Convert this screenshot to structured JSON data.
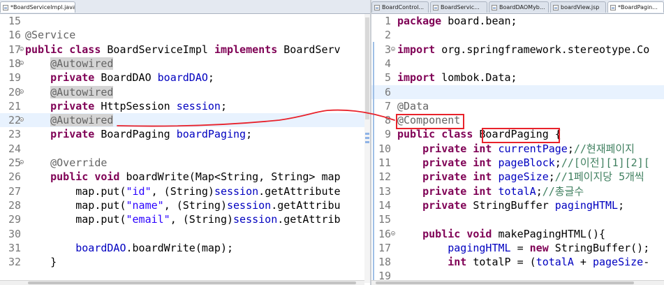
{
  "left_editor": {
    "tab": {
      "label": "*BoardServiceImpl.java",
      "close": "☒"
    },
    "lines": [
      {
        "num": "15",
        "tokens": []
      },
      {
        "num": "16",
        "tokens": [
          {
            "t": "@Service",
            "c": "ann"
          }
        ]
      },
      {
        "num": "17",
        "fold": true,
        "tokens": [
          {
            "t": "public class ",
            "c": "kw"
          },
          {
            "t": "BoardServiceImpl ",
            "c": ""
          },
          {
            "t": "implements ",
            "c": "kw"
          },
          {
            "t": "BoardServ",
            "c": ""
          }
        ]
      },
      {
        "num": "18",
        "fold": true,
        "tokens": [
          {
            "t": "    ",
            "c": ""
          },
          {
            "t": "@Autowired",
            "c": "ann occ"
          }
        ]
      },
      {
        "num": "19",
        "tokens": [
          {
            "t": "    ",
            "c": ""
          },
          {
            "t": "private ",
            "c": "kw"
          },
          {
            "t": "BoardDAO ",
            "c": ""
          },
          {
            "t": "boardDAO",
            "c": "field"
          },
          {
            "t": ";",
            "c": ""
          }
        ]
      },
      {
        "num": "20",
        "fold": true,
        "tokens": [
          {
            "t": "    ",
            "c": ""
          },
          {
            "t": "@Autowired",
            "c": "ann occ"
          }
        ]
      },
      {
        "num": "21",
        "tokens": [
          {
            "t": "    ",
            "c": ""
          },
          {
            "t": "private ",
            "c": "kw"
          },
          {
            "t": "HttpSession ",
            "c": ""
          },
          {
            "t": "session",
            "c": "field"
          },
          {
            "t": ";",
            "c": ""
          }
        ]
      },
      {
        "num": "22",
        "fold": true,
        "current": true,
        "tokens": [
          {
            "t": "    ",
            "c": ""
          },
          {
            "t": "@Autowired",
            "c": "ann occ"
          }
        ]
      },
      {
        "num": "23",
        "tokens": [
          {
            "t": "    ",
            "c": ""
          },
          {
            "t": "private ",
            "c": "kw"
          },
          {
            "t": "BoardPaging ",
            "c": ""
          },
          {
            "t": "boardPaging",
            "c": "field"
          },
          {
            "t": ";",
            "c": ""
          }
        ]
      },
      {
        "num": "24",
        "tokens": []
      },
      {
        "num": "25",
        "fold": true,
        "tokens": [
          {
            "t": "    ",
            "c": ""
          },
          {
            "t": "@Override",
            "c": "ann"
          }
        ]
      },
      {
        "num": "26",
        "tokens": [
          {
            "t": "    ",
            "c": ""
          },
          {
            "t": "public void ",
            "c": "kw"
          },
          {
            "t": "boardWrite(Map<String, String> ",
            "c": ""
          },
          {
            "t": "map",
            "c": ""
          }
        ]
      },
      {
        "num": "27",
        "tokens": [
          {
            "t": "        map.put(",
            "c": ""
          },
          {
            "t": "\"id\"",
            "c": "str"
          },
          {
            "t": ", (String)",
            "c": ""
          },
          {
            "t": "session",
            "c": "field"
          },
          {
            "t": ".getAttribute",
            "c": ""
          }
        ]
      },
      {
        "num": "28",
        "tokens": [
          {
            "t": "        map.put(",
            "c": ""
          },
          {
            "t": "\"name\"",
            "c": "str"
          },
          {
            "t": ", (String)",
            "c": ""
          },
          {
            "t": "session",
            "c": "field"
          },
          {
            "t": ".getAttribu",
            "c": ""
          }
        ]
      },
      {
        "num": "29",
        "tokens": [
          {
            "t": "        map.put(",
            "c": ""
          },
          {
            "t": "\"email\"",
            "c": "str"
          },
          {
            "t": ", (String)",
            "c": ""
          },
          {
            "t": "session",
            "c": "field"
          },
          {
            "t": ".getAttrib",
            "c": ""
          }
        ]
      },
      {
        "num": "30",
        "tokens": []
      },
      {
        "num": "31",
        "tokens": [
          {
            "t": "        ",
            "c": ""
          },
          {
            "t": "boardDAO",
            "c": "field"
          },
          {
            "t": ".boardWrite(map);",
            "c": ""
          }
        ]
      },
      {
        "num": "32",
        "tokens": [
          {
            "t": "    }",
            "c": ""
          }
        ]
      }
    ]
  },
  "right_editor": {
    "tabs": [
      {
        "label": "BoardControl..."
      },
      {
        "label": "BoardServic..."
      },
      {
        "label": "BoardDAOMyb..."
      },
      {
        "label": "boardView.jsp"
      },
      {
        "label": "*BoardPagin...",
        "active": true,
        "close": "☒"
      }
    ],
    "lines": [
      {
        "num": "1",
        "tokens": [
          {
            "t": "package ",
            "c": "kw"
          },
          {
            "t": "board.bean;",
            "c": ""
          }
        ]
      },
      {
        "num": "2",
        "tokens": []
      },
      {
        "num": "3",
        "fold": true,
        "tokens": [
          {
            "t": "import ",
            "c": "kw"
          },
          {
            "t": "org.springframework.stereotype.Co",
            "c": ""
          }
        ]
      },
      {
        "num": "4",
        "tokens": []
      },
      {
        "num": "5",
        "tokens": [
          {
            "t": "import ",
            "c": "kw"
          },
          {
            "t": "lombok.Data;",
            "c": ""
          }
        ]
      },
      {
        "num": "6",
        "current": true,
        "tokens": []
      },
      {
        "num": "7",
        "tokens": [
          {
            "t": "@Data",
            "c": "ann"
          }
        ]
      },
      {
        "num": "8",
        "tokens": [
          {
            "t": "@Component",
            "c": "ann"
          }
        ]
      },
      {
        "num": "9",
        "tokens": [
          {
            "t": "public class ",
            "c": "kw"
          },
          {
            "t": "BoardPaging",
            "c": ""
          },
          {
            "t": " {",
            "c": ""
          }
        ]
      },
      {
        "num": "10",
        "tokens": [
          {
            "t": "    ",
            "c": ""
          },
          {
            "t": "private int ",
            "c": "kw"
          },
          {
            "t": "currentPage",
            "c": "field"
          },
          {
            "t": ";",
            "c": ""
          },
          {
            "t": "//현재페이지",
            "c": "cmt"
          }
        ]
      },
      {
        "num": "11",
        "tokens": [
          {
            "t": "    ",
            "c": ""
          },
          {
            "t": "private int ",
            "c": "kw"
          },
          {
            "t": "pageBlock",
            "c": "field"
          },
          {
            "t": ";",
            "c": ""
          },
          {
            "t": "//[이전][1][2][",
            "c": "cmt"
          }
        ]
      },
      {
        "num": "12",
        "tokens": [
          {
            "t": "    ",
            "c": ""
          },
          {
            "t": "private int ",
            "c": "kw"
          },
          {
            "t": "pageSize",
            "c": "field"
          },
          {
            "t": ";",
            "c": ""
          },
          {
            "t": "//1페이지당 5개씩",
            "c": "cmt"
          }
        ]
      },
      {
        "num": "13",
        "tokens": [
          {
            "t": "    ",
            "c": ""
          },
          {
            "t": "private int ",
            "c": "kw"
          },
          {
            "t": "totalA",
            "c": "field"
          },
          {
            "t": ";",
            "c": ""
          },
          {
            "t": "//총글수",
            "c": "cmt"
          }
        ]
      },
      {
        "num": "14",
        "tokens": [
          {
            "t": "    ",
            "c": ""
          },
          {
            "t": "private ",
            "c": "kw"
          },
          {
            "t": "StringBuffer ",
            "c": ""
          },
          {
            "t": "pagingHTML",
            "c": "field"
          },
          {
            "t": ";",
            "c": ""
          }
        ]
      },
      {
        "num": "15",
        "tokens": []
      },
      {
        "num": "16",
        "fold": true,
        "tokens": [
          {
            "t": "    ",
            "c": ""
          },
          {
            "t": "public void ",
            "c": "kw"
          },
          {
            "t": "makePagingHTML(){",
            "c": ""
          }
        ]
      },
      {
        "num": "17",
        "tokens": [
          {
            "t": "        ",
            "c": ""
          },
          {
            "t": "pagingHTML",
            "c": "field"
          },
          {
            "t": " = ",
            "c": ""
          },
          {
            "t": "new ",
            "c": "kw"
          },
          {
            "t": "StringBuffer();",
            "c": ""
          }
        ]
      },
      {
        "num": "18",
        "tokens": [
          {
            "t": "        ",
            "c": ""
          },
          {
            "t": "int ",
            "c": "kw"
          },
          {
            "t": "totalP = (",
            "c": ""
          },
          {
            "t": "totalA",
            "c": "field"
          },
          {
            "t": " + ",
            "c": ""
          },
          {
            "t": "pageSize",
            "c": "field"
          },
          {
            "t": "-",
            "c": ""
          }
        ]
      },
      {
        "num": "19",
        "tokens": []
      }
    ]
  },
  "colors": {
    "keyword": "#7f0055",
    "annotation": "#646464",
    "field": "#0000c0",
    "string": "#2a00ff",
    "comment": "#3f7f5f",
    "highlight_box": "#e8222b"
  }
}
